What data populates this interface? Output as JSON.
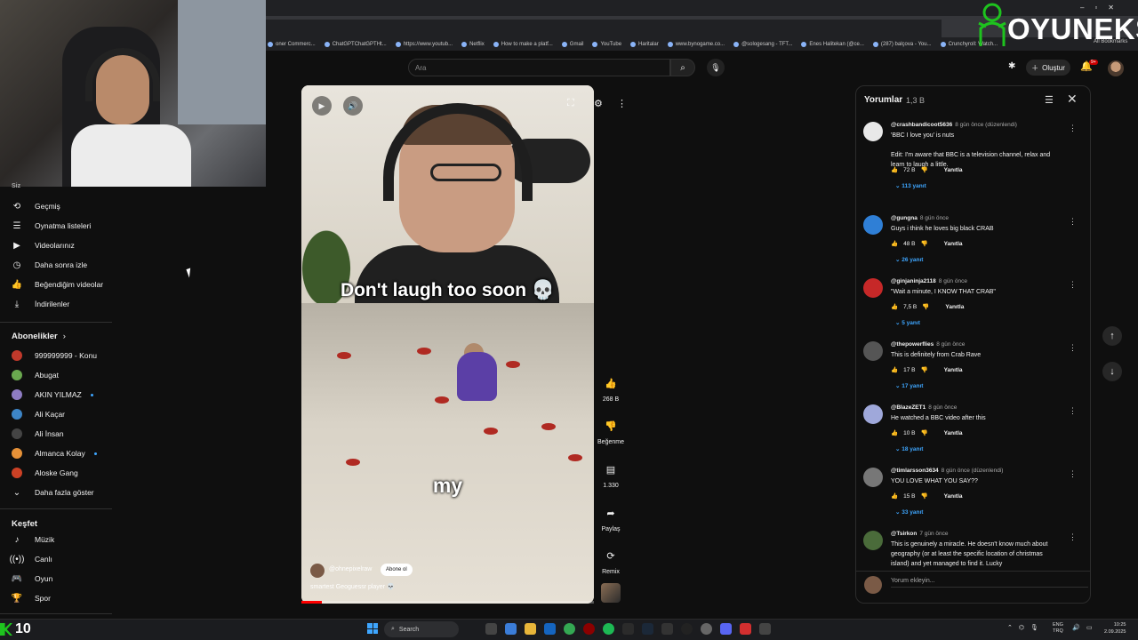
{
  "browser": {
    "bookmarks": [
      {
        "label": "oner Commerc..."
      },
      {
        "label": "ChatGPTChatGPTHt..."
      },
      {
        "label": "https://www.youtub..."
      },
      {
        "label": "Netflix"
      },
      {
        "label": "How to make a platf..."
      },
      {
        "label": "Gmail"
      },
      {
        "label": "YouTube"
      },
      {
        "label": "Haritalar"
      },
      {
        "label": "www.bynogame.co..."
      },
      {
        "label": "@sologesang - TFT..."
      },
      {
        "label": "Enes Halitekan (@ce..."
      },
      {
        "label": "(287) balçova - You..."
      },
      {
        "label": "Crunchyroll: Watch..."
      }
    ],
    "all_bookmarks": "All Bookmarks"
  },
  "logo": {
    "text": "OYUNEKS"
  },
  "header": {
    "search_placeholder": "Ara",
    "create_label": "Oluştur",
    "notification_count": "9+"
  },
  "sidebar": {
    "you_label": "Siz",
    "you_items": [
      {
        "label": "Geçmiş",
        "icon": "history-icon",
        "glyph": "⟲"
      },
      {
        "label": "Oynatma listeleri",
        "icon": "playlist-icon",
        "glyph": "☰"
      },
      {
        "label": "Videolarınız",
        "icon": "your-videos-icon",
        "glyph": "▶"
      },
      {
        "label": "Daha sonra izle",
        "icon": "watch-later-icon",
        "glyph": "◷"
      },
      {
        "label": "Beğendiğim videolar",
        "icon": "liked-icon",
        "glyph": "👍"
      },
      {
        "label": "İndirilenler",
        "icon": "download-icon",
        "glyph": "⤓"
      }
    ],
    "subscriptions_label": "Abonelikler",
    "subscriptions": [
      {
        "label": "999999999 - Konu",
        "color": "#c0392b",
        "dot": false
      },
      {
        "label": "Abugat",
        "color": "#6aa84f",
        "dot": false
      },
      {
        "label": "AKIN YILMAZ",
        "color": "#8e7cc3",
        "dot": true
      },
      {
        "label": "Ali Kaçar",
        "color": "#3d85c6",
        "dot": false
      },
      {
        "label": "Ali İnsan",
        "color": "#444444",
        "dot": false
      },
      {
        "label": "Almanca Kolay",
        "color": "#e69138",
        "dot": true
      },
      {
        "label": "Aloske Gang",
        "color": "#cc4125",
        "dot": false
      }
    ],
    "show_more": "Daha fazla göster",
    "explore_label": "Keşfet",
    "explore_items": [
      {
        "label": "Müzik",
        "icon": "music-icon",
        "glyph": "♪"
      },
      {
        "label": "Canlı",
        "icon": "live-icon",
        "glyph": "((•))"
      },
      {
        "label": "Oyun",
        "icon": "gaming-icon",
        "glyph": "🎮"
      },
      {
        "label": "Spor",
        "icon": "sports-icon",
        "glyph": "🏆"
      }
    ]
  },
  "video": {
    "caption_top": "Don't laugh too soon 💀",
    "caption_bottom": "my",
    "channel": "@ohnepixelraw",
    "subscribe_label": "Abone ol",
    "title": "smartest Geoguessr player 💀",
    "progress": 0.07
  },
  "actions": {
    "like_count": "268 B",
    "dislike_label": "Beğenme",
    "comment_count": "1.330",
    "share_label": "Paylaş",
    "remix_label": "Remix"
  },
  "comments": {
    "title": "Yorumlar",
    "count": "1,3 B",
    "reply_label": "Yanıtla",
    "add_placeholder": "Yorum ekleyin...",
    "items": [
      {
        "user": "@crashbandicoot5636",
        "time": "8 gün önce (düzenlendi)",
        "text": "'BBC I love you' is nuts\n\nEdit: I'm aware that BBC is a television channel, relax and learn to laugh a little.",
        "likes": "72 B",
        "replies": "113 yanıt",
        "avatar_color": "#e8e8e8"
      },
      {
        "user": "@gungna",
        "time": "8 gün önce",
        "text": "Guys i think he loves big black CRAB",
        "likes": "48 B",
        "replies": "26 yanıt",
        "avatar_color": "#2f7fd6"
      },
      {
        "user": "@ginjaninja2118",
        "time": "8 gün önce",
        "text": "\"Wait a minute, I KNOW THAT CRAB\"",
        "likes": "7,5 B",
        "replies": "5 yanıt",
        "avatar_color": "#c62828"
      },
      {
        "user": "@thepowerflies",
        "time": "8 gün önce",
        "text": "This is definitely from Crab Rave",
        "likes": "17 B",
        "replies": "17 yanıt",
        "avatar_color": "#555555"
      },
      {
        "user": "@BlazeZET1",
        "time": "8 gün önce",
        "text": "He watched a BBC video after this",
        "likes": "10 B",
        "replies": "18 yanıt",
        "avatar_color": "#9fa8da"
      },
      {
        "user": "@timlarsson3634",
        "time": "8 gün önce (düzenlendi)",
        "text": "YOU LOVE WHAT YOU SAY??",
        "likes": "15 B",
        "replies": "33 yanıt",
        "avatar_color": "#777777"
      },
      {
        "user": "@Tsirkon",
        "time": "7 gün önce",
        "text": "This is genuinely a miracle. He doesn't know much about geography (or at least the specific location of christmas island) and yet managed to find it. Lucky",
        "likes": "",
        "replies": "",
        "avatar_color": "#4a6b3a"
      }
    ]
  },
  "taskbar": {
    "badge_number": "10",
    "search_label": "Search",
    "lang_top": "ENG",
    "lang_bottom": "TRQ",
    "time": "10:25",
    "date": "2.09.2025"
  }
}
